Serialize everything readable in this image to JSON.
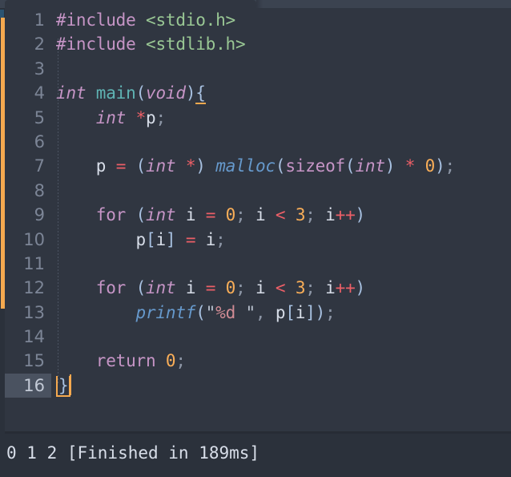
{
  "app": {
    "name": "sublime-text-editor",
    "theme_background": "#303641",
    "accent_color": "#f5a94f",
    "gutter_text_color": "#7c8596"
  },
  "tabbar": {
    "active_tab_present": true
  },
  "markers": {
    "modified_bar_color": "#f5a94f",
    "selection_segment_color": "#2b5472"
  },
  "editor": {
    "line_numbers": [
      "1",
      "2",
      "3",
      "4",
      "5",
      "6",
      "7",
      "8",
      "9",
      "10",
      "11",
      "12",
      "13",
      "14",
      "15",
      "16"
    ],
    "active_line": "16",
    "lines": [
      {
        "n": "1",
        "tokens": [
          {
            "t": "#include",
            "c": "t-pre"
          },
          {
            "t": " ",
            "c": "t-var"
          },
          {
            "t": "<stdio.h>",
            "c": "t-str"
          }
        ]
      },
      {
        "n": "2",
        "tokens": [
          {
            "t": "#include",
            "c": "t-pre"
          },
          {
            "t": " ",
            "c": "t-var"
          },
          {
            "t": "<stdlib.h>",
            "c": "t-str"
          }
        ]
      },
      {
        "n": "3",
        "tokens": []
      },
      {
        "n": "4",
        "tokens": [
          {
            "t": "int",
            "c": "t-type"
          },
          {
            "t": " ",
            "c": "t-var"
          },
          {
            "t": "main",
            "c": "t-fn"
          },
          {
            "t": "(",
            "c": "t-punc"
          },
          {
            "t": "void",
            "c": "t-type"
          },
          {
            "t": ")",
            "c": "t-punc"
          },
          {
            "t": "{",
            "c": "t-punc brace-match"
          }
        ]
      },
      {
        "n": "5",
        "tokens": [
          {
            "t": "    ",
            "c": "t-var"
          },
          {
            "t": "int",
            "c": "t-type"
          },
          {
            "t": " ",
            "c": "t-var"
          },
          {
            "t": "*",
            "c": "t-op"
          },
          {
            "t": "p",
            "c": "t-var"
          },
          {
            "t": ";",
            "c": "t-semi"
          }
        ]
      },
      {
        "n": "6",
        "tokens": []
      },
      {
        "n": "7",
        "tokens": [
          {
            "t": "    ",
            "c": "t-var"
          },
          {
            "t": "p",
            "c": "t-var"
          },
          {
            "t": " ",
            "c": "t-var"
          },
          {
            "t": "=",
            "c": "t-op"
          },
          {
            "t": " ",
            "c": "t-var"
          },
          {
            "t": "(",
            "c": "t-punc"
          },
          {
            "t": "int",
            "c": "t-type"
          },
          {
            "t": " ",
            "c": "t-var"
          },
          {
            "t": "*",
            "c": "t-op"
          },
          {
            "t": ")",
            "c": "t-punc"
          },
          {
            "t": " ",
            "c": "t-var"
          },
          {
            "t": "malloc",
            "c": "t-lib"
          },
          {
            "t": "(",
            "c": "t-punc"
          },
          {
            "t": "sizeof",
            "c": "t-kw"
          },
          {
            "t": "(",
            "c": "t-punc"
          },
          {
            "t": "int",
            "c": "t-type"
          },
          {
            "t": ")",
            "c": "t-punc"
          },
          {
            "t": " ",
            "c": "t-var"
          },
          {
            "t": "*",
            "c": "t-op"
          },
          {
            "t": " ",
            "c": "t-var"
          },
          {
            "t": "0",
            "c": "t-num"
          },
          {
            "t": ")",
            "c": "t-punc"
          },
          {
            "t": ";",
            "c": "t-semi"
          }
        ]
      },
      {
        "n": "8",
        "tokens": []
      },
      {
        "n": "9",
        "tokens": [
          {
            "t": "    ",
            "c": "t-var"
          },
          {
            "t": "for",
            "c": "t-kw"
          },
          {
            "t": " ",
            "c": "t-var"
          },
          {
            "t": "(",
            "c": "t-punc"
          },
          {
            "t": "int",
            "c": "t-type"
          },
          {
            "t": " ",
            "c": "t-var"
          },
          {
            "t": "i",
            "c": "t-var"
          },
          {
            "t": " ",
            "c": "t-var"
          },
          {
            "t": "=",
            "c": "t-op"
          },
          {
            "t": " ",
            "c": "t-var"
          },
          {
            "t": "0",
            "c": "t-num"
          },
          {
            "t": ";",
            "c": "t-semi"
          },
          {
            "t": " ",
            "c": "t-var"
          },
          {
            "t": "i",
            "c": "t-var"
          },
          {
            "t": " ",
            "c": "t-var"
          },
          {
            "t": "<",
            "c": "t-op"
          },
          {
            "t": " ",
            "c": "t-var"
          },
          {
            "t": "3",
            "c": "t-num"
          },
          {
            "t": ";",
            "c": "t-semi"
          },
          {
            "t": " ",
            "c": "t-var"
          },
          {
            "t": "i",
            "c": "t-var"
          },
          {
            "t": "++",
            "c": "t-op"
          },
          {
            "t": ")",
            "c": "t-punc"
          }
        ]
      },
      {
        "n": "10",
        "tokens": [
          {
            "t": "        ",
            "c": "t-var"
          },
          {
            "t": "p",
            "c": "t-var"
          },
          {
            "t": "[",
            "c": "t-punc"
          },
          {
            "t": "i",
            "c": "t-var"
          },
          {
            "t": "]",
            "c": "t-punc"
          },
          {
            "t": " ",
            "c": "t-var"
          },
          {
            "t": "=",
            "c": "t-op"
          },
          {
            "t": " ",
            "c": "t-var"
          },
          {
            "t": "i",
            "c": "t-var"
          },
          {
            "t": ";",
            "c": "t-semi"
          }
        ]
      },
      {
        "n": "11",
        "tokens": []
      },
      {
        "n": "12",
        "tokens": [
          {
            "t": "    ",
            "c": "t-var"
          },
          {
            "t": "for",
            "c": "t-kw"
          },
          {
            "t": " ",
            "c": "t-var"
          },
          {
            "t": "(",
            "c": "t-punc"
          },
          {
            "t": "int",
            "c": "t-type"
          },
          {
            "t": " ",
            "c": "t-var"
          },
          {
            "t": "i",
            "c": "t-var"
          },
          {
            "t": " ",
            "c": "t-var"
          },
          {
            "t": "=",
            "c": "t-op"
          },
          {
            "t": " ",
            "c": "t-var"
          },
          {
            "t": "0",
            "c": "t-num"
          },
          {
            "t": ";",
            "c": "t-semi"
          },
          {
            "t": " ",
            "c": "t-var"
          },
          {
            "t": "i",
            "c": "t-var"
          },
          {
            "t": " ",
            "c": "t-var"
          },
          {
            "t": "<",
            "c": "t-op"
          },
          {
            "t": " ",
            "c": "t-var"
          },
          {
            "t": "3",
            "c": "t-num"
          },
          {
            "t": ";",
            "c": "t-semi"
          },
          {
            "t": " ",
            "c": "t-var"
          },
          {
            "t": "i",
            "c": "t-var"
          },
          {
            "t": "++",
            "c": "t-op"
          },
          {
            "t": ")",
            "c": "t-punc"
          }
        ]
      },
      {
        "n": "13",
        "tokens": [
          {
            "t": "        ",
            "c": "t-var"
          },
          {
            "t": "printf",
            "c": "t-lib"
          },
          {
            "t": "(",
            "c": "t-punc"
          },
          {
            "t": "\"",
            "c": "t-qt"
          },
          {
            "t": "%d",
            "c": "t-fmt"
          },
          {
            "t": " ",
            "c": "t-fmt"
          },
          {
            "t": "\"",
            "c": "t-qt"
          },
          {
            "t": ",",
            "c": "t-semi"
          },
          {
            "t": " ",
            "c": "t-var"
          },
          {
            "t": "p",
            "c": "t-var"
          },
          {
            "t": "[",
            "c": "t-punc"
          },
          {
            "t": "i",
            "c": "t-var"
          },
          {
            "t": "]",
            "c": "t-punc"
          },
          {
            "t": ")",
            "c": "t-punc"
          },
          {
            "t": ";",
            "c": "t-semi"
          }
        ]
      },
      {
        "n": "14",
        "tokens": []
      },
      {
        "n": "15",
        "tokens": [
          {
            "t": "    ",
            "c": "t-var"
          },
          {
            "t": "return",
            "c": "t-kw"
          },
          {
            "t": " ",
            "c": "t-var"
          },
          {
            "t": "0",
            "c": "t-num"
          },
          {
            "t": ";",
            "c": "t-semi"
          }
        ]
      },
      {
        "n": "16",
        "tokens": [
          {
            "t": "}",
            "c": "t-punc brace-box"
          }
        ],
        "caret": true
      }
    ],
    "source_text": "#include <stdio.h>\n#include <stdlib.h>\n\nint main(void){\n    int *p;\n\n    p = (int *) malloc(sizeof(int) * 0);\n\n    for (int i = 0; i < 3; i++)\n        p[i] = i;\n\n    for (int i = 0; i < 3; i++)\n        printf(\"%d \", p[i]);\n\n    return 0;\n}",
    "language": "C"
  },
  "output_panel": {
    "text": "0 1 2 [Finished in 189ms]",
    "program_output": "0 1 2",
    "build_status": "[Finished in 189ms]",
    "build_time_ms": "189"
  }
}
